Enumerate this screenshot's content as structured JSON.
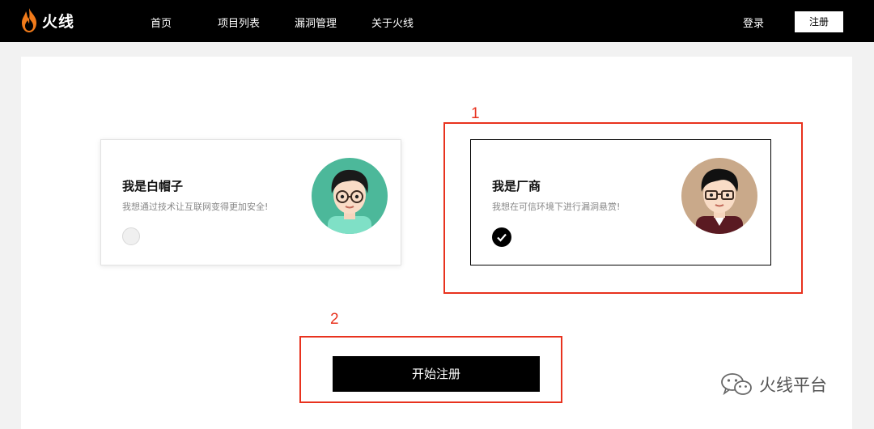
{
  "header": {
    "logo_text": "火线",
    "nav": [
      "首页",
      "项目列表",
      "漏洞管理",
      "关于火线"
    ],
    "login_label": "登录",
    "register_label": "注册"
  },
  "roles": {
    "whitehat": {
      "title": "我是白帽子",
      "description": "我想通过技术让互联网变得更加安全!",
      "selected": false
    },
    "vendor": {
      "title": "我是厂商",
      "description": "我想在可信环境下进行漏洞悬赏!",
      "selected": true
    }
  },
  "annotations": {
    "label_1": "1",
    "label_2": "2"
  },
  "start_button_label": "开始注册",
  "watermark": {
    "text": "火线平台"
  },
  "colors": {
    "nav_bg": "#000000",
    "annotation": "#e8321e",
    "primary_button": "#000000",
    "whitehat_avatar_bg": "#4cb89a",
    "vendor_avatar_bg": "#c9a98a"
  },
  "icons": [
    "flame-logo-icon",
    "checkmark-icon",
    "wechat-icon"
  ]
}
